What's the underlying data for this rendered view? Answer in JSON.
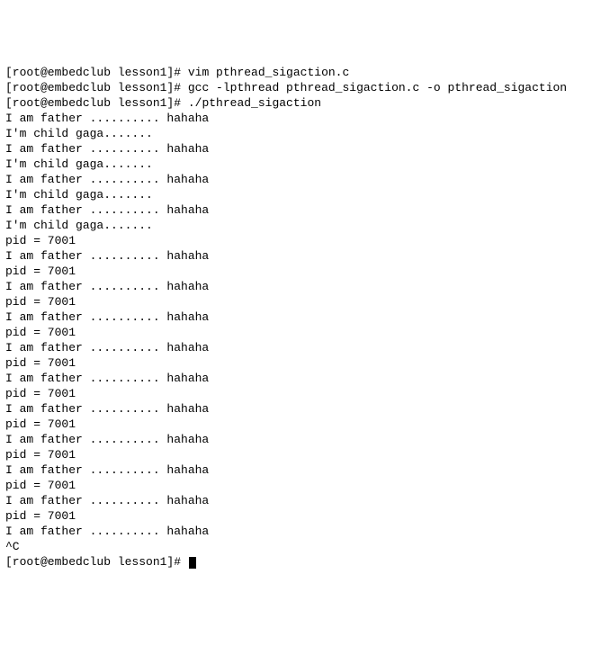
{
  "terminal": {
    "lines": [
      {
        "prompt": "[root@embedclub lesson1]# ",
        "command": "vim pthread_sigaction.c"
      },
      {
        "prompt": "[root@embedclub lesson1]# ",
        "command": "gcc -lpthread pthread_sigaction.c -o pthread_sigaction"
      },
      {
        "prompt": "[root@embedclub lesson1]# ",
        "command": "./pthread_sigaction"
      },
      {
        "output": "I am father .......... hahaha"
      },
      {
        "output": "I'm child gaga......."
      },
      {
        "output": "I am father .......... hahaha"
      },
      {
        "output": "I'm child gaga......."
      },
      {
        "output": "I am father .......... hahaha"
      },
      {
        "output": "I'm child gaga......."
      },
      {
        "output": "I am father .......... hahaha"
      },
      {
        "output": "I'm child gaga......."
      },
      {
        "output": "pid = 7001"
      },
      {
        "output": "I am father .......... hahaha"
      },
      {
        "output": "pid = 7001"
      },
      {
        "output": "I am father .......... hahaha"
      },
      {
        "output": "pid = 7001"
      },
      {
        "output": "I am father .......... hahaha"
      },
      {
        "output": "pid = 7001"
      },
      {
        "output": "I am father .......... hahaha"
      },
      {
        "output": "pid = 7001"
      },
      {
        "output": "I am father .......... hahaha"
      },
      {
        "output": "pid = 7001"
      },
      {
        "output": "I am father .......... hahaha"
      },
      {
        "output": "pid = 7001"
      },
      {
        "output": "I am father .......... hahaha"
      },
      {
        "output": "pid = 7001"
      },
      {
        "output": "I am father .......... hahaha"
      },
      {
        "output": "pid = 7001"
      },
      {
        "output": "I am father .......... hahaha"
      },
      {
        "output": "pid = 7001"
      },
      {
        "output": "I am father .......... hahaha"
      },
      {
        "output": "^C"
      },
      {
        "prompt": "[root@embedclub lesson1]# ",
        "cursor": true
      }
    ]
  }
}
